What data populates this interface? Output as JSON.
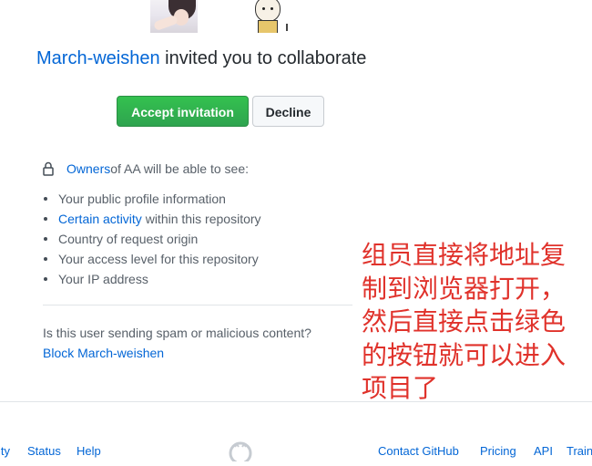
{
  "header": {
    "inviter": "March-weishen",
    "invite_text": " invited you to collaborate"
  },
  "buttons": {
    "accept": "Accept invitation",
    "decline": "Decline"
  },
  "owners_line": {
    "owners_link": "Owners",
    "rest": " of AA will be able to see:"
  },
  "permissions": {
    "item0": "Your public profile information",
    "item1_link": "Certain activity",
    "item1_rest": " within this repository",
    "item2": "Country of request origin",
    "item3": "Your access level for this repository",
    "item4": "Your IP address"
  },
  "spam": {
    "question": "Is this user sending spam or malicious content?",
    "block_link": "Block March-weishen"
  },
  "annotation": {
    "text": "组员直接将地址复制到浏览器打开，然后直接点击绿色的按钮就可以进入项目了",
    "color": "#e0322b"
  },
  "footer": {
    "partial_left": "ity",
    "status": "Status",
    "help": "Help",
    "contact": "Contact GitHub",
    "pricing": "Pricing",
    "api": "API",
    "train": "Train"
  },
  "icons": {
    "lock": "lock-icon",
    "github": "github-mark-icon"
  },
  "colors": {
    "accent_link": "#0366d6",
    "accept_green": "#2ea44f"
  }
}
